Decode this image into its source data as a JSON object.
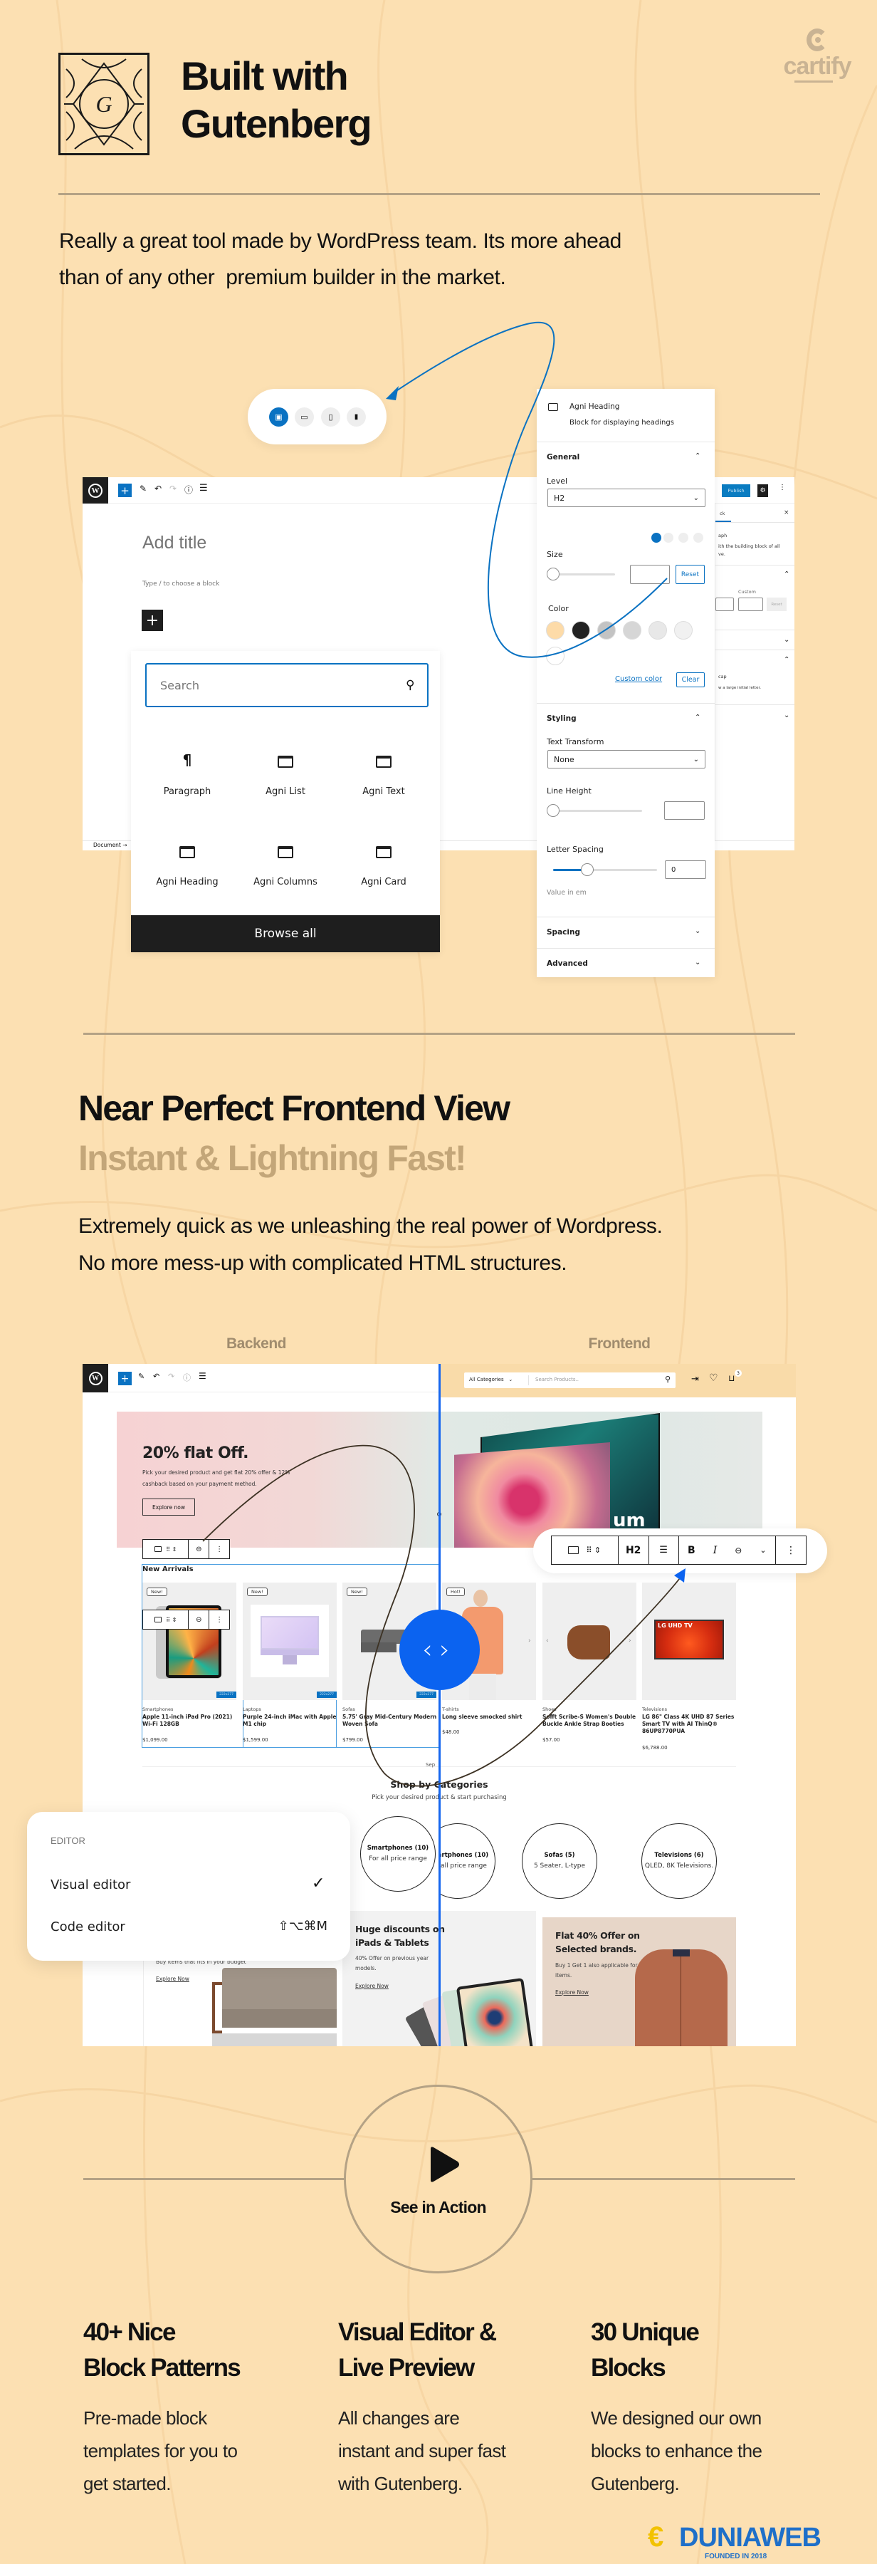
{
  "colors": {
    "background": "#fce0b2",
    "accent_blue": "#0a72c2",
    "divider": "#b4a285",
    "subheading": "#c3a679",
    "cartify_logo": "#c9b393",
    "wp_dark": "#1e1e1e",
    "compare_blue": "#0b63f0"
  },
  "brand": {
    "logo_text": "cartify",
    "logo_icon": "cartify-c-icon"
  },
  "section1": {
    "logo_icon": "gutenberg-logo-icon",
    "logo_letter": "G",
    "title_line1": "Built with",
    "title_line2": "Gutenberg",
    "description_line1": "Really a great tool made by WordPress team. Its more ahead",
    "description_line2": "than of any other  premium builder in the market."
  },
  "device_switcher": {
    "icons": [
      "desktop-icon",
      "laptop-icon",
      "tablet-icon",
      "mobile-icon"
    ],
    "active": 0
  },
  "editor1": {
    "title_placeholder": "Add title",
    "block_hint": "Type / to choose a block",
    "breadcrumb": "Document",
    "breadcrumb_arrow": "→",
    "ghost_sidebar": {
      "publish": "Publish",
      "tab": "ck",
      "block_name": "aph",
      "block_desc1": "ith the building block of all",
      "block_desc2": "ve.",
      "custom": "Custom",
      "reset": "Reset",
      "dropcap": "cap",
      "dropcap_desc": "w a large initial letter."
    }
  },
  "inserter": {
    "search_placeholder": "Search",
    "blocks": [
      {
        "label": "Paragraph",
        "icon": "pilcrow-icon"
      },
      {
        "label": "Agni List",
        "icon": "block-icon"
      },
      {
        "label": "Agni Text",
        "icon": "block-icon"
      },
      {
        "label": "Agni Heading",
        "icon": "block-icon"
      },
      {
        "label": "Agni Columns",
        "icon": "block-icon"
      },
      {
        "label": "Agni Card",
        "icon": "block-icon"
      }
    ],
    "browse_all": "Browse all"
  },
  "inspector": {
    "block_title": "Agni Heading",
    "block_desc": "Block for displaying headings",
    "general": "General",
    "level_label": "Level",
    "level_value": "H2",
    "size_label": "Size",
    "reset": "Reset",
    "color_label": "Color",
    "swatches": [
      "#fddba8",
      "#222222",
      "#c3c3c3",
      "#d6d6d6",
      "#e8e8e8",
      "#f1f1f1",
      "#ffffff"
    ],
    "custom_color": "Custom color",
    "clear": "Clear",
    "styling": "Styling",
    "text_transform_label": "Text Transform",
    "text_transform_value": "None",
    "line_height_label": "Line Height",
    "letter_spacing_label": "Letter Spacing",
    "letter_spacing_value": "0",
    "letter_spacing_fill": 0.33,
    "value_hint": "Value in em",
    "spacing": "Spacing",
    "advanced": "Advanced"
  },
  "section2": {
    "title": "Near Perfect Frontend View",
    "subtitle": "Instant & Lightning Fast!",
    "description_line1": "Extremely quick as we unleashing the real power of Wordpress.",
    "description_line2": "No more mess-up with complicated HTML structures.",
    "backend_label": "Backend",
    "frontend_label": "Frontend"
  },
  "frontend_header": {
    "category_select": "All Categories",
    "search_placeholder": "Search Products..",
    "cart_count": "3"
  },
  "banner": {
    "title": "20% flat Off.",
    "desc_line1": "Pick your desired product and get flat 20% offer & 12%",
    "desc_line2": "cashback based on your payment method.",
    "button": "Explore now",
    "tv_text": "um"
  },
  "heading_toolbar": {
    "level": "H2",
    "bold": "B",
    "italic": "I"
  },
  "new_arrivals": {
    "title": "New Arrivals",
    "size_tag": "222x277",
    "products": [
      {
        "badge": "New!",
        "category": "Smartphones",
        "name1": "Apple 11-inch iPad Pro (2021)",
        "name2": "Wi-Fi 128GB",
        "name3": "",
        "price": "$1,099.00"
      },
      {
        "badge": "New!",
        "category": "Laptops",
        "name1": "Purple 24-inch iMac with Apple",
        "name2": "M1 chip",
        "name3": "",
        "price": "$1,599.00"
      },
      {
        "badge": "New!",
        "category": "Sofas",
        "name1": "5.75' Gray Mid-Century Modern",
        "name2": "Woven Sofa",
        "name3": "",
        "price": "$799.00"
      },
      {
        "badge": "Hot!",
        "category": "T-shirts",
        "name1": "Long sleeve smocked shirt",
        "name2": "",
        "name3": "",
        "price": "$48.00"
      },
      {
        "badge": "",
        "category": "Shoes",
        "name1": "Sofft Scribe-S Women's Double",
        "name2": "Buckle Ankle Strap Booties",
        "name3": "",
        "price": "$57.00"
      },
      {
        "badge": "",
        "category": "Televisions",
        "name1": "LG 86\" Class 4K UHD 87 Series",
        "name2": "Smart TV with AI ThinQ®",
        "name3": "86UP8770PUA",
        "price": "$6,788.00"
      }
    ],
    "tv_logo_text": "LG UHD TV"
  },
  "separator_label": "Sep",
  "categories": {
    "title": "Shop by Categories",
    "subtitle": "Pick your desired product & start purchasing",
    "items": [
      {
        "name": "Smartphones (10)",
        "desc": "For all price range"
      },
      {
        "name": "Sofas (5)",
        "desc": "5 Seater, L-type"
      },
      {
        "name": "Televisions (6)",
        "desc": "QLED, 8K Televisions."
      }
    ]
  },
  "promos": [
    {
      "title1": "",
      "title2": "",
      "desc1": "Buy items that fits in your budget",
      "desc2": "",
      "link": "Explore Now"
    },
    {
      "title1": "Huge discounts on",
      "title2": "iPads & Tablets",
      "desc1": "40% Offer on previous year",
      "desc2": "models.",
      "link": "Explore Now"
    },
    {
      "title1": "Flat 40% Offer on",
      "title2": "Selected brands.",
      "desc1": "Buy 1 Get 1 also applicable for",
      "desc2": "items.",
      "link": "Explore Now"
    }
  ],
  "editor_menu": {
    "heading": "EDITOR",
    "items": [
      {
        "label": "Visual editor",
        "checked": true,
        "shortcut": ""
      },
      {
        "label": "Code editor",
        "checked": false,
        "shortcut": "⇧⌥⌘M"
      }
    ]
  },
  "video": {
    "label": "See in Action",
    "icon": "play-icon"
  },
  "features": [
    {
      "title1": "40+ Nice",
      "title2": "Block Patterns",
      "desc": [
        "Pre-made block",
        "templates for you to",
        "get started."
      ]
    },
    {
      "title1": "Visual Editor &",
      "title2": "Live Preview",
      "desc": [
        "All changes are",
        "instant and super fast",
        "with Gutenberg."
      ]
    },
    {
      "title1": "30 Unique",
      "title2": "Blocks",
      "desc": [
        "We designed our own",
        "blocks to enhance the",
        "Gutenberg."
      ]
    }
  ],
  "watermark": {
    "text": "DUNIAWEB",
    "subtext": "FOUNDED IN 2018"
  }
}
